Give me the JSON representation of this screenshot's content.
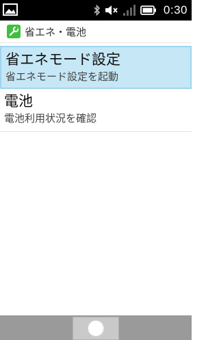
{
  "status_bar": {
    "time": "0:30",
    "icons": [
      "image-icon",
      "bluetooth-icon",
      "mute-icon",
      "signal-icon",
      "battery-icon"
    ]
  },
  "title_bar": {
    "icon": "wrench-icon",
    "title": "省エネ・電池"
  },
  "list": {
    "items": [
      {
        "title": "省エネモード設定",
        "subtitle": "省エネモード設定を起動"
      },
      {
        "title": "電池",
        "subtitle": "電池利用状況を確認"
      }
    ]
  },
  "nav_bar": {
    "home_icon": "home-icon"
  },
  "colors": {
    "status_bar_bg": "#000000",
    "selected_bg": "#c6e7f6",
    "title_icon_bg": "#3fbf3f",
    "nav_bar_bg": "#9a9a9a"
  }
}
